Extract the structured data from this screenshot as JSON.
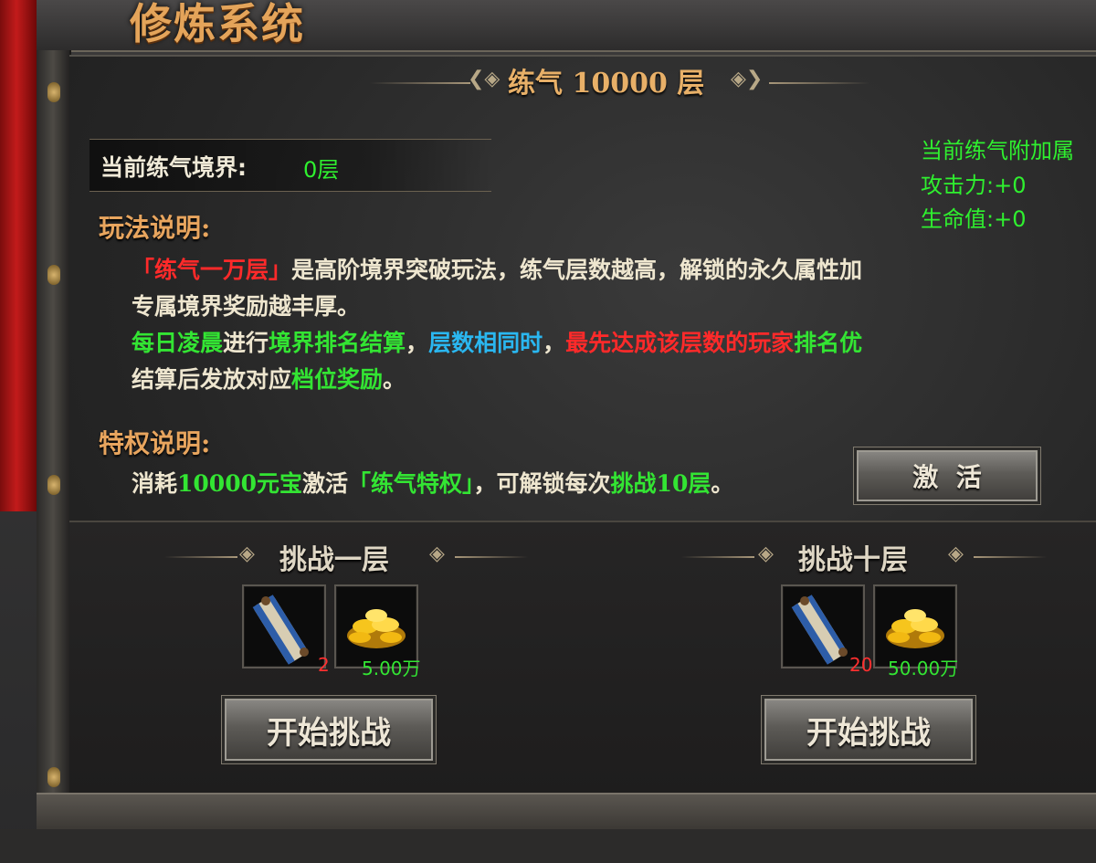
{
  "window": {
    "title": "修炼系统"
  },
  "header": {
    "title": "练气 10000 层"
  },
  "realm": {
    "label": "当前练气境界:",
    "value": "0层"
  },
  "attributes": {
    "title": "当前练气附加属",
    "attack": "攻击力:+0",
    "hp": "生命值:+0"
  },
  "gameplay": {
    "title": "玩法说明:",
    "line1": {
      "p1": "「练气一万层」",
      "p2": "是高阶境界突破玩法，练气层数越高，解锁的永久属性加"
    },
    "line2": "专属境界奖励越丰厚。",
    "line3": {
      "p1": "每日凌晨",
      "p2": "进行",
      "p3": "境界排名结算",
      "p4": "，",
      "p5": "层数相同时",
      "p6": "，",
      "p7": "最先达成该层数的玩家",
      "p8": "排名优"
    },
    "line4": {
      "p1": "结算后发放对应",
      "p2": "档位奖励",
      "p3": "。"
    }
  },
  "privilege": {
    "title": "特权说明:",
    "line": {
      "p1": "消耗",
      "p2": "10000元宝",
      "p3": "激活",
      "p4": "「练气特权」",
      "p5": "，可解锁每次",
      "p6": "挑战10层",
      "p7": "。"
    },
    "activate_label": "激  活"
  },
  "challenge_one": {
    "title": "挑战一层",
    "scroll_qty": "2",
    "gold_qty": "5.00万",
    "button": "开始挑战"
  },
  "challenge_ten": {
    "title": "挑战十层",
    "scroll_qty": "20",
    "gold_qty": "50.00万",
    "button": "开始挑战"
  },
  "icons": {
    "item1": "scroll-icon",
    "item2": "gold-ingots-icon"
  },
  "colors": {
    "accent": "#e8a55e",
    "green": "#33e533",
    "cyan": "#2ab7f0",
    "red": "#ff2a2a"
  }
}
